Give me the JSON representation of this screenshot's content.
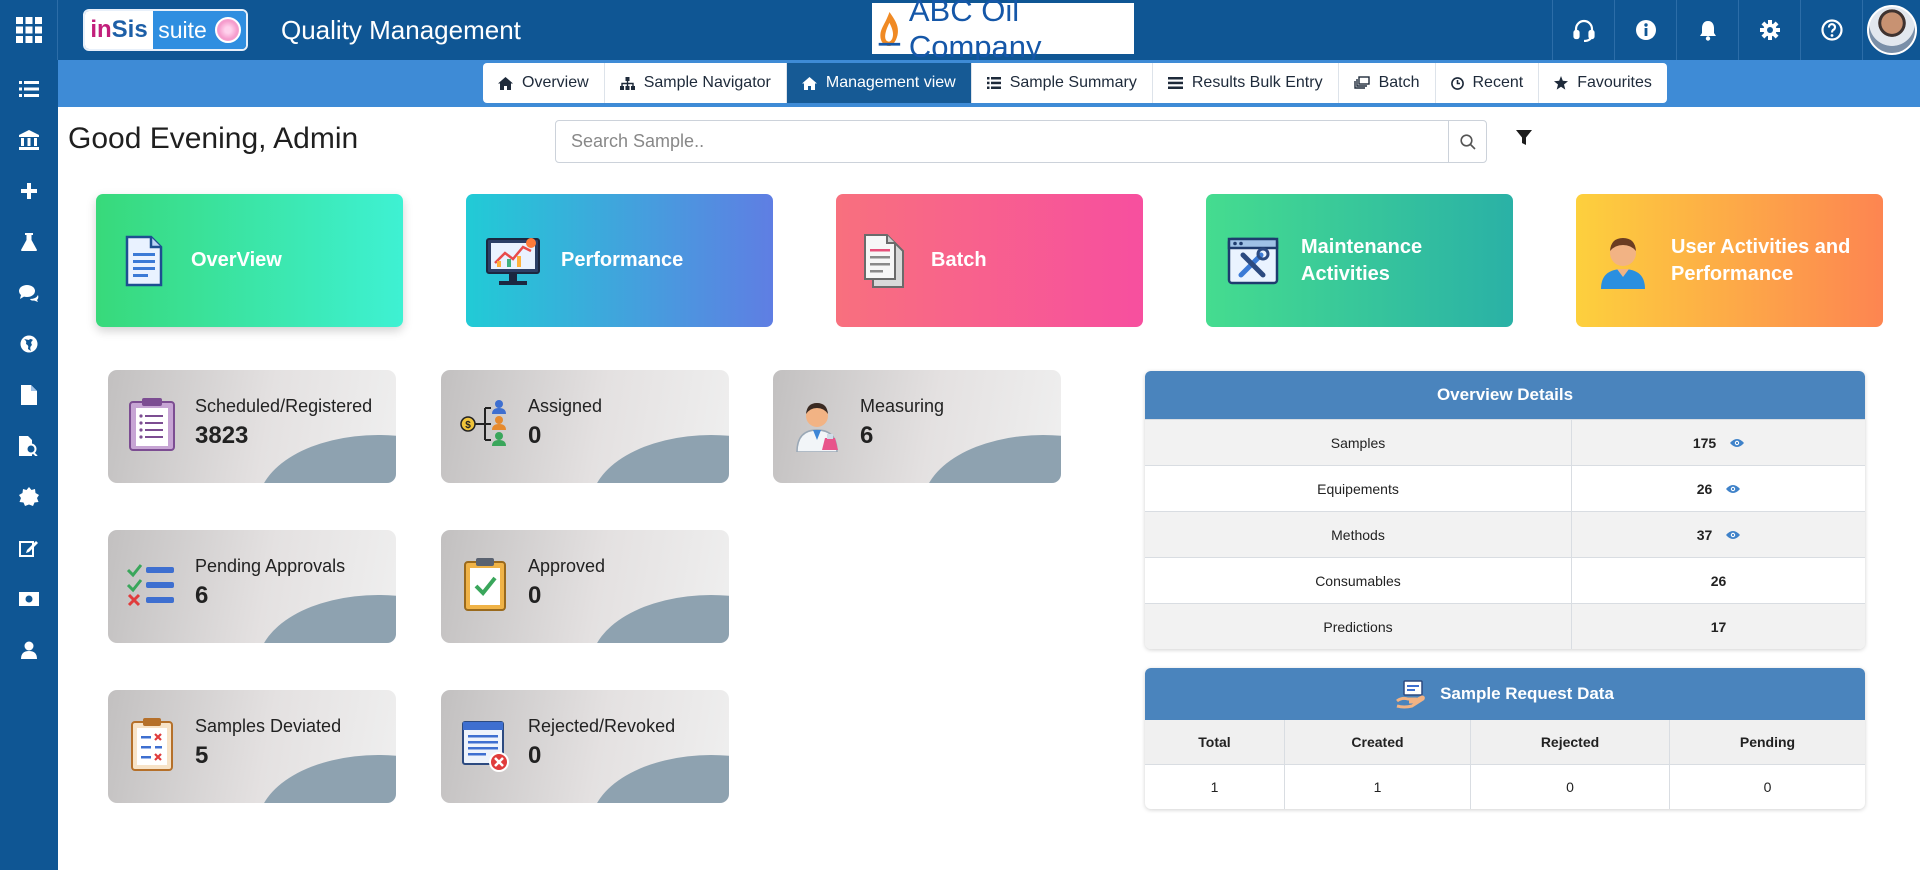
{
  "header": {
    "logo_prefix": "in",
    "logo_main": "Sis",
    "logo_suite": "suite",
    "app_title": "Quality Management",
    "company_name": "ABC Oil Company",
    "icons": [
      "headset-icon",
      "info-icon",
      "bell-icon",
      "gear-icon",
      "help-icon"
    ]
  },
  "sidebar": {
    "items": [
      "list-icon",
      "bank-icon",
      "plus-icon",
      "flask-icon",
      "chat-icon",
      "globe-icon",
      "file-icon",
      "file-search-icon",
      "badge-icon",
      "edit-icon",
      "money-icon",
      "user-icon"
    ]
  },
  "nav": {
    "tabs": [
      {
        "label": "Overview",
        "icon": "home-icon"
      },
      {
        "label": "Sample Navigator",
        "icon": "sitemap-icon"
      },
      {
        "label": "Management view",
        "icon": "home-icon",
        "active": true
      },
      {
        "label": "Sample Summary",
        "icon": "list-icon"
      },
      {
        "label": "Results Bulk Entry",
        "icon": "table-icon"
      },
      {
        "label": "Batch",
        "icon": "clone-icon"
      },
      {
        "label": "Recent",
        "icon": "clock-icon"
      },
      {
        "label": "Favourites",
        "icon": "star-icon"
      }
    ]
  },
  "greeting": "Good Evening, Admin",
  "search": {
    "placeholder": "Search Sample.."
  },
  "cards": [
    {
      "label": "OverView"
    },
    {
      "label": "Performance"
    },
    {
      "label": "Batch"
    },
    {
      "label": "Maintenance Activities"
    },
    {
      "label": "User Activities and Performance"
    }
  ],
  "stats": [
    {
      "label": "Scheduled/Registered",
      "value": "3823"
    },
    {
      "label": "Assigned",
      "value": "0"
    },
    {
      "label": "Measuring",
      "value": "6"
    },
    {
      "label": "Pending Approvals",
      "value": "6"
    },
    {
      "label": "Approved",
      "value": "0"
    },
    {
      "label": "Samples Deviated",
      "value": "5"
    },
    {
      "label": "Rejected/Revoked",
      "value": "0"
    }
  ],
  "overview_details": {
    "title": "Overview Details",
    "rows": [
      {
        "label": "Samples",
        "value": "175",
        "viewable": true
      },
      {
        "label": "Equipements",
        "value": "26",
        "viewable": true
      },
      {
        "label": "Methods",
        "value": "37",
        "viewable": true
      },
      {
        "label": "Consumables",
        "value": "26",
        "viewable": false
      },
      {
        "label": "Predictions",
        "value": "17",
        "viewable": false
      }
    ]
  },
  "sample_request": {
    "title": "Sample Request Data",
    "columns": [
      "Total",
      "Created",
      "Rejected",
      "Pending"
    ],
    "values": [
      "1",
      "1",
      "0",
      "0"
    ]
  },
  "colors": {
    "brand_blue": "#0f5694",
    "nav_blue": "#3e8bd6",
    "active_tab": "#165a95",
    "panel_head": "#4a84bd"
  }
}
